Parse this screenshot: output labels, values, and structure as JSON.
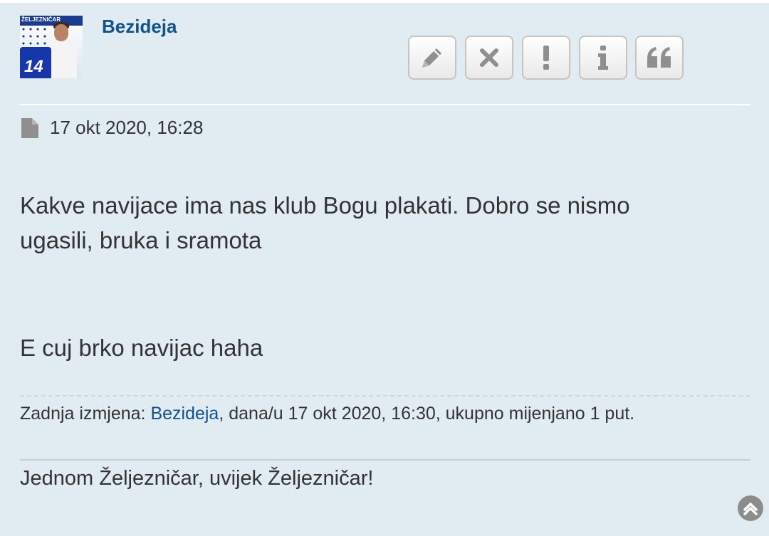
{
  "post": {
    "author": "Bezideja",
    "avatar_caption": "ŽELJEZNIČAR",
    "avatar_number": "14",
    "timestamp": "17 okt 2020, 16:28",
    "content_line1": "Kakve navijace ima nas klub Bogu plakati. Dobro se nismo",
    "content_line2": "ugasili, bruka i sramota",
    "content_line3": "E cuj brko navijac haha",
    "edit_prefix": "Zadnja izmjena: ",
    "edit_user": "Bezideja",
    "edit_suffix": ", dana/u 17 okt 2020, 16:30, ukupno mijenjano 1 put.",
    "signature": "Jednom Željezničar, uvijek Željezničar!"
  },
  "buttons": [
    {
      "name": "edit",
      "icon": "pencil-icon"
    },
    {
      "name": "delete",
      "icon": "close-icon"
    },
    {
      "name": "report",
      "icon": "exclamation-icon"
    },
    {
      "name": "info",
      "icon": "info-icon"
    },
    {
      "name": "quote",
      "icon": "quote-icon"
    }
  ],
  "colors": {
    "background": "#e1ebf2",
    "link": "#105289",
    "text": "#333333",
    "icon": "#8f8f8f"
  }
}
